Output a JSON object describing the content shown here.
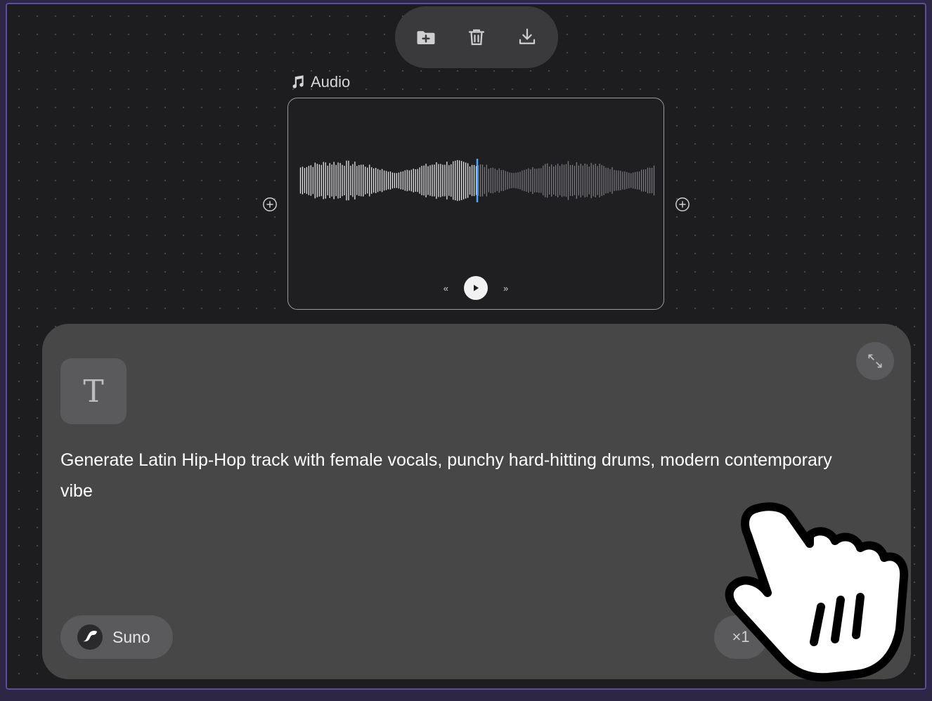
{
  "toolbar": {
    "icons": [
      "folder-plus-icon",
      "trash-icon",
      "download-icon"
    ]
  },
  "audio_node": {
    "label": "Audio",
    "label_icon": "music-note-icon",
    "playback_progress": 0.5,
    "controls": {
      "rewind": "«",
      "forward": "»"
    }
  },
  "prompt_panel": {
    "type_icon_glyph": "T",
    "prompt_text": "Generate Latin Hip-Hop track with female vocals, punchy hard-hitting drums, modern contemporary vibe",
    "model_name": "Suno",
    "count_label": "×1"
  },
  "colors": {
    "canvas_bg": "#1d1d1f",
    "panel_bg": "#474748",
    "playhead": "#4da6ff",
    "frame_border": "#5b4e9a"
  }
}
